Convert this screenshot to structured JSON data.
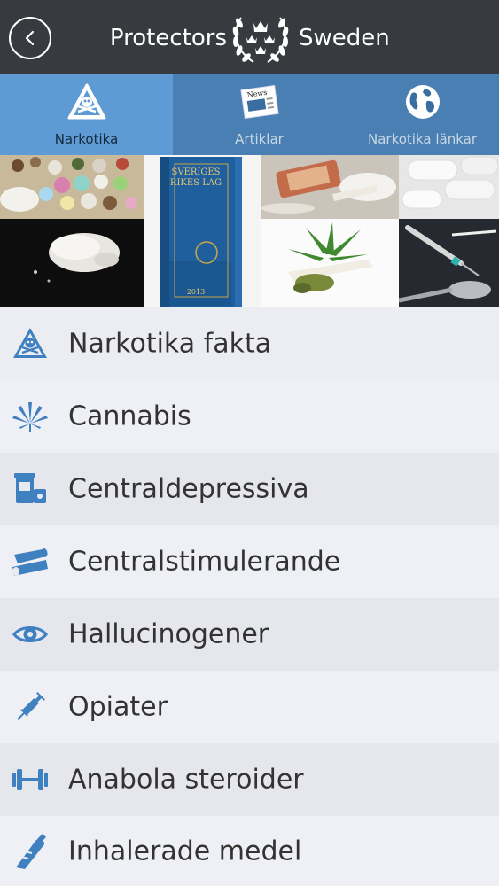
{
  "header": {
    "brand_left": "Protectors",
    "brand_right": "Sweden"
  },
  "tabs": [
    {
      "label": "Narkotika",
      "icon": "hazard-skull-icon",
      "active": true
    },
    {
      "label": "Artiklar",
      "icon": "newspaper-icon",
      "active": false
    },
    {
      "label": "Narkotika länkar",
      "icon": "globe-icon",
      "active": false
    }
  ],
  "collage": {
    "book_title": "SVERIGES RIKES LAG",
    "book_year": "2013"
  },
  "menu": [
    {
      "label": "Narkotika fakta",
      "icon": "hazard-skull-icon"
    },
    {
      "label": "Cannabis",
      "icon": "cannabis-leaf-icon"
    },
    {
      "label": "Centraldepressiva",
      "icon": "pills-icon"
    },
    {
      "label": "Centralstimulerande",
      "icon": "rolled-bill-icon"
    },
    {
      "label": "Hallucinogener",
      "icon": "eye-icon"
    },
    {
      "label": "Opiater",
      "icon": "syringe-icon"
    },
    {
      "label": "Anabola steroider",
      "icon": "dumbbell-icon"
    },
    {
      "label": "Inhalerade medel",
      "icon": "aerosol-icon"
    }
  ],
  "colors": {
    "header_bg": "#373b40",
    "tabbar_bg": "#4a7fb3",
    "tab_active_bg": "#5e9ad3",
    "icon_blue": "#3f80c0"
  }
}
